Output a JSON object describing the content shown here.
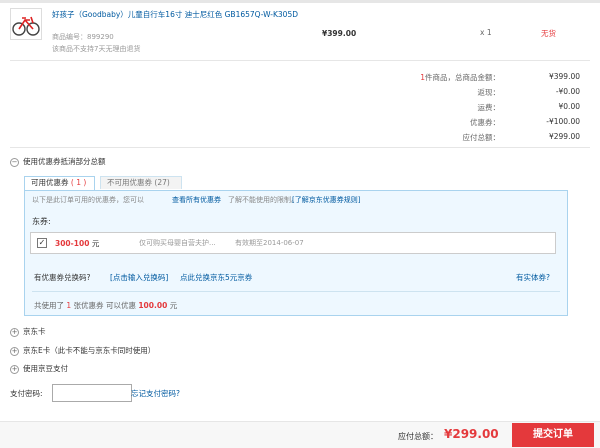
{
  "product": {
    "name": "好孩子（Goodbaby）儿童自行车16寸 迪士尼红色 GB1657Q-W-K305D",
    "code_label": "商品编号：",
    "code": "899290",
    "note": "该商品不支持7天无理由退货",
    "price": "¥399.00",
    "qty": "x 1",
    "stock": "无货"
  },
  "summary": {
    "count_num": "1",
    "count_suffix": "件商品，总商品金额：",
    "total": "¥399.00",
    "rebate_label": "返现：",
    "rebate": "-¥0.00",
    "shipping_label": "运费：",
    "shipping": "¥0.00",
    "coupon_label": "优惠券：",
    "coupon": "-¥100.00",
    "due_label": "应付总额：",
    "due": "¥299.00"
  },
  "coupon_section": {
    "toggle": "使用优惠券抵消部分总额",
    "tab_usable_label": "可用优惠券",
    "tab_usable_count": "( 1 )",
    "tab_unusable_label": "不可用优惠券",
    "tab_unusable_count": "(27)",
    "hint": "以下是此订单可用的优惠券，您可以",
    "hint_link1": "查看所有优惠券",
    "hint_mid": "了解不能使用的限制。",
    "hint_link2": "[了解京东优惠券规则]",
    "dong_label": "东券:",
    "coupon_name": "300-100",
    "coupon_unit": "元",
    "coupon_desc": "仅可购买母婴自营夫护...",
    "coupon_expire": "有效期至2014-06-07",
    "redeem_q": "有优惠券兑换码?",
    "redeem_link": "[点击输入兑换码]",
    "redeem_link2": "点此兑换京东5元京券",
    "entity_link": "有实体券?",
    "used_prefix": "共使用了",
    "used_count": "1",
    "used_mid": "张优惠券  可以优惠",
    "used_amount": "100.00",
    "used_suffix": "元"
  },
  "other_sections": {
    "jd_card": "京东卡",
    "jd_ecard": "京东E卡（此卡不能与京东卡同时使用）",
    "jd_bean": "使用京豆支付"
  },
  "payment": {
    "pwd_label": "支付密码:",
    "forgot_link": "忘记支付密码?"
  },
  "footer": {
    "due_label": "应付总额：",
    "due_value": "¥299.00",
    "submit": "提交订单"
  },
  "colors": {
    "accent": "#e4393c",
    "link": "#005aa0",
    "coupon_bg": "#eef8ff",
    "coupon_border": "#a9d3ee"
  }
}
